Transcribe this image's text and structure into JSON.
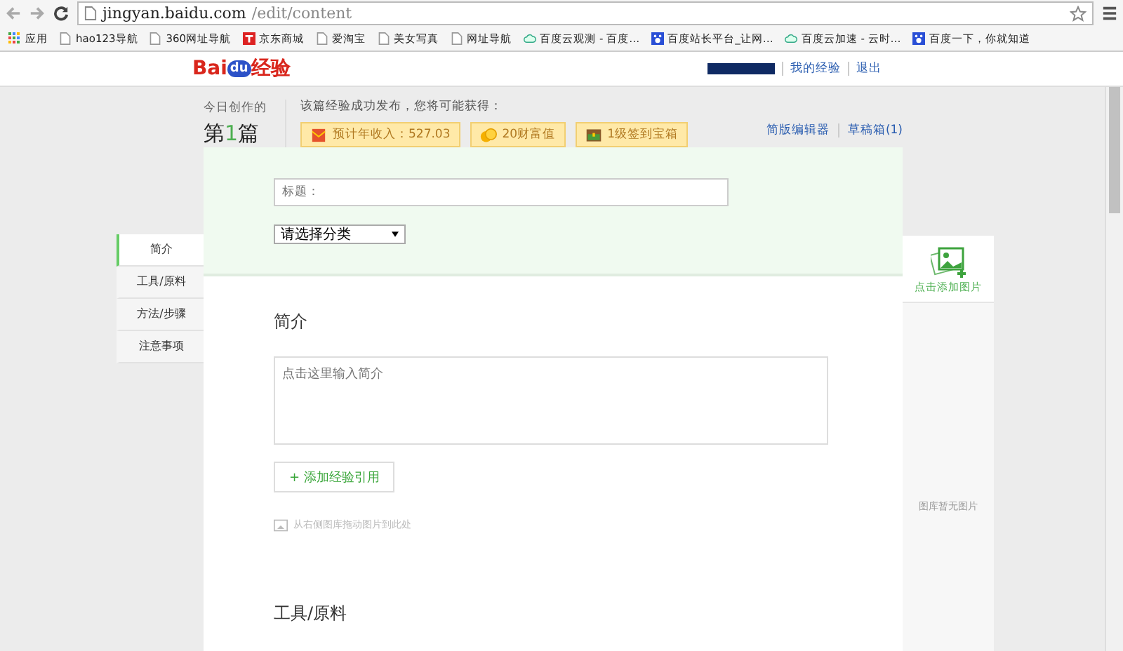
{
  "browser": {
    "url_host": "jingyan.baidu.com",
    "url_path": "/edit/content"
  },
  "bookmarks": [
    {
      "label": "应用",
      "kind": "apps"
    },
    {
      "label": "hao123导航",
      "kind": "page"
    },
    {
      "label": "360网址导航",
      "kind": "page"
    },
    {
      "label": "京东商城",
      "kind": "shop"
    },
    {
      "label": "爱淘宝",
      "kind": "page"
    },
    {
      "label": "美女写真",
      "kind": "page"
    },
    {
      "label": "网址导航",
      "kind": "page"
    },
    {
      "label": "百度云观测 - 百度…",
      "kind": "cloud"
    },
    {
      "label": "百度站长平台_让网…",
      "kind": "paw"
    },
    {
      "label": "百度云加速 - 云时…",
      "kind": "cloud"
    },
    {
      "label": "百度一下，你就知道",
      "kind": "paw"
    }
  ],
  "header": {
    "logo": {
      "left": "Bai",
      "mark": "du",
      "right": "经验"
    },
    "links": [
      "我的经验",
      "退出"
    ]
  },
  "today": {
    "label": "今日创作的",
    "count_prefix": "第",
    "count": "1",
    "count_suffix": "篇"
  },
  "rewards": {
    "intro": "该篇经验成功发布，您将可能获得：",
    "items": [
      {
        "label": "预计年收入：527.03",
        "kind": "income"
      },
      {
        "label": "20财富值",
        "kind": "coins"
      },
      {
        "label": "1级签到宝箱",
        "kind": "chest"
      }
    ]
  },
  "top_links": [
    "简版编辑器",
    "草稿箱(1)"
  ],
  "nav": [
    {
      "label": "简介",
      "selected": true
    },
    {
      "label": "工具/原料",
      "selected": false
    },
    {
      "label": "方法/步骤",
      "selected": false
    },
    {
      "label": "注意事项",
      "selected": false
    }
  ],
  "form": {
    "title_placeholder": "标题：",
    "category": "请选择分类",
    "intro_heading": "简介",
    "intro_placeholder": "点击这里输入简介",
    "add_reference": "+ 添加经验引用",
    "drag_hint": "从右侧图库拖动图片到此处",
    "tools_heading": "工具/原料"
  },
  "gallery": {
    "add_label": "点击添加图片",
    "empty": "图库暂无图片"
  }
}
